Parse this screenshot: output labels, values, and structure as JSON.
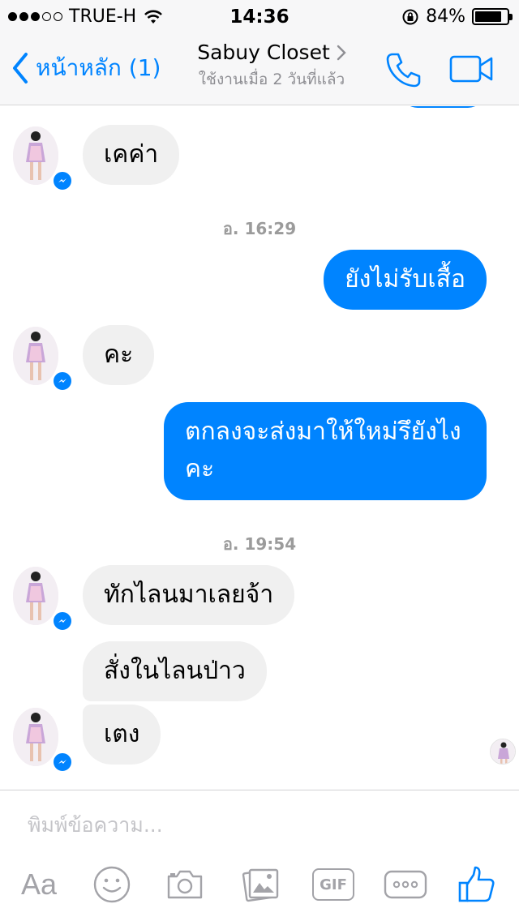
{
  "status_bar": {
    "carrier": "TRUE-H",
    "time": "14:36",
    "battery_percent": "84%",
    "battery_level": 0.84,
    "signal_bars_filled": 3,
    "signal_bars_total": 5
  },
  "nav": {
    "back_label": "หน้าหลัก (1)",
    "title": "Sabuy Closet",
    "subtitle": "ใช้งานเมื่อ 2 วันที่แล้ว",
    "accent_color": "#0084ff"
  },
  "messages": [
    {
      "direction": "in",
      "text": "เคค่า"
    },
    {
      "type": "timestamp",
      "text": "อ. 16:29"
    },
    {
      "direction": "out",
      "text": "ยังไม่รับเสื้อ"
    },
    {
      "direction": "in",
      "text": "คะ"
    },
    {
      "direction": "out",
      "text": "ตกลงจะส่งมาให้ใหม่รึยังไง คะ"
    },
    {
      "type": "timestamp",
      "text": "อ. 19:54"
    },
    {
      "direction": "in",
      "text": "ทักไลนมาเลยจ้า"
    },
    {
      "direction": "in",
      "text": "สั่งในไลนป่าว"
    },
    {
      "direction": "in",
      "text": "เตง"
    }
  ],
  "composer": {
    "placeholder": "พิมพ์ข้อความ...",
    "toolbar": {
      "aa_label": "Aa",
      "gif_label": "GIF"
    }
  },
  "colors": {
    "outgoing_bubble": "#0084ff",
    "incoming_bubble": "#f0f0f0",
    "icon_gray": "#9b9ba0"
  }
}
